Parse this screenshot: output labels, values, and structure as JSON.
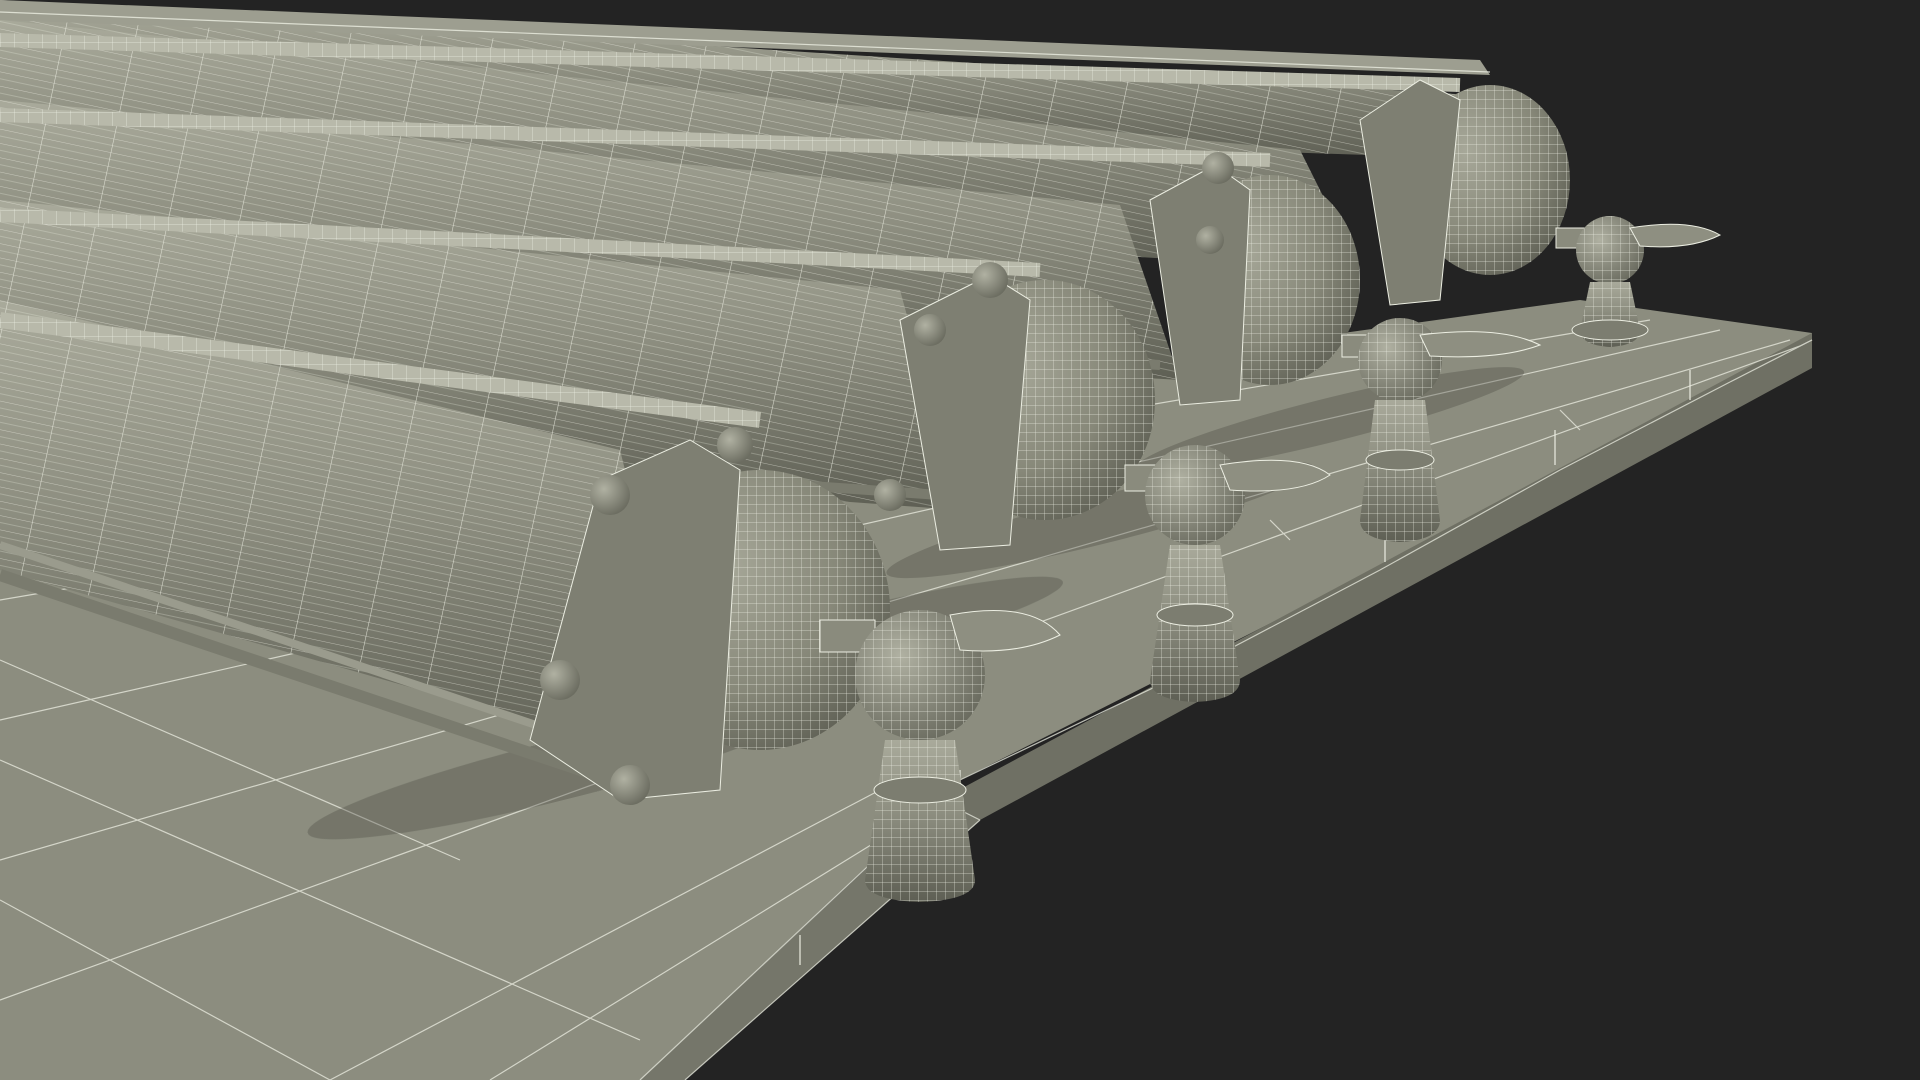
{
  "scene": {
    "subject": "wireframe-3d-render",
    "background_color": "#232323",
    "surface_color": "#8b8c7d",
    "shadow_color": "#6c6d60",
    "highlight_color": "#b3b4a5",
    "wire_color": "#eceee2",
    "column_count": 5,
    "visible_text": []
  }
}
